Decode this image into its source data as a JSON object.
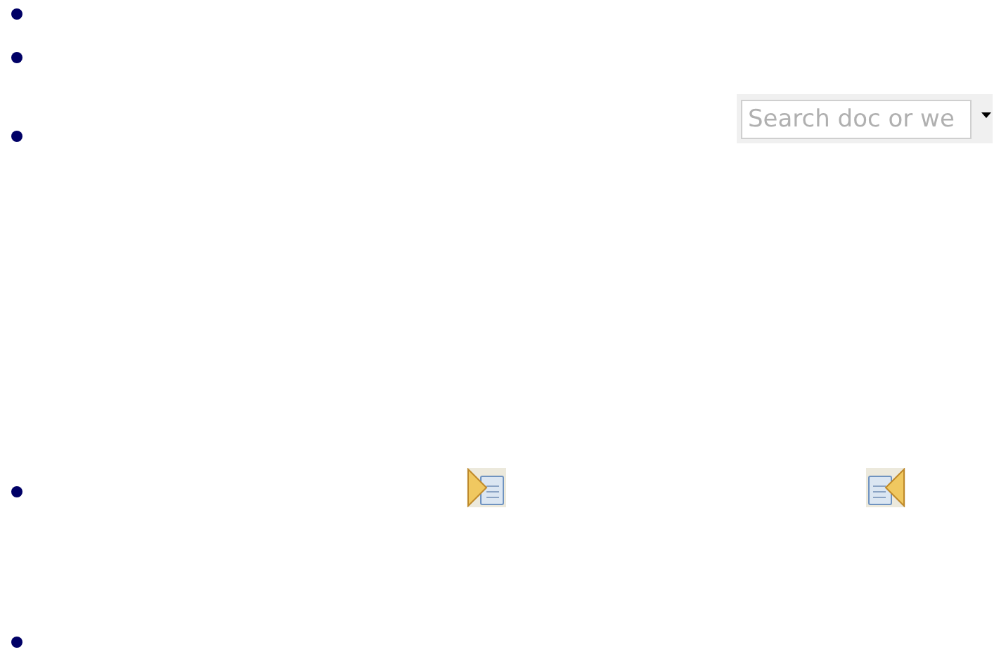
{
  "search": {
    "placeholder": "Search doc or we"
  }
}
